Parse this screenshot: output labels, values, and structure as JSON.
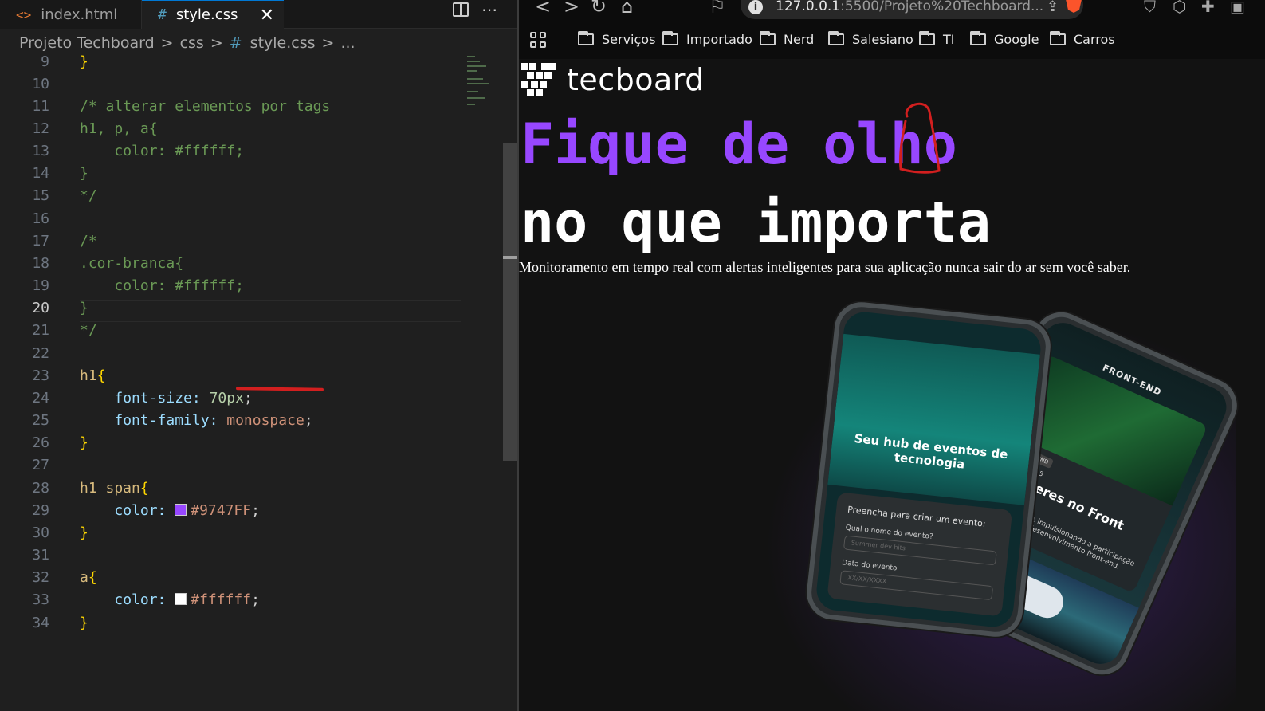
{
  "editor": {
    "tabs": [
      {
        "icon": "<>",
        "label": "index.html"
      },
      {
        "icon": "#",
        "label": "style.css"
      }
    ],
    "close_glyph": "✕",
    "more_glyph": "⋯",
    "breadcrumb": [
      "Projeto Techboard",
      "css",
      "style.css",
      "..."
    ],
    "breadcrumb_sep": ">",
    "breadcrumb_hash": "#",
    "active_line": 20,
    "lines": [
      {
        "n": "9"
      },
      {
        "n": "10"
      },
      {
        "n": "11"
      },
      {
        "n": "12"
      },
      {
        "n": "13"
      },
      {
        "n": "14"
      },
      {
        "n": "15"
      },
      {
        "n": "16"
      },
      {
        "n": "17"
      },
      {
        "n": "18"
      },
      {
        "n": "19"
      },
      {
        "n": "20"
      },
      {
        "n": "21"
      },
      {
        "n": "22"
      },
      {
        "n": "23"
      },
      {
        "n": "24"
      },
      {
        "n": "25"
      },
      {
        "n": "26"
      },
      {
        "n": "27"
      },
      {
        "n": "28"
      },
      {
        "n": "29"
      },
      {
        "n": "30"
      },
      {
        "n": "31"
      },
      {
        "n": "32"
      },
      {
        "n": "33"
      },
      {
        "n": "34"
      }
    ],
    "code": {
      "l9": "}",
      "l11": "/* alterar elementos por tags",
      "l12_sel": "h1, p, a",
      "l13_prop": "color:",
      "l13_val": "#ffffff;",
      "l15": "*/",
      "l17": "/*",
      "l18": ".cor-branca{",
      "l19_prop": "color:",
      "l19_val": "#ffffff;",
      "l20": "}",
      "l21": "*/",
      "l23_sel": "h1",
      "l24_prop": "font-size:",
      "l24_num": "70px",
      "l25_prop": "font-family:",
      "l25_val": "monospace",
      "l26": "}",
      "l28_sel": "h1 span",
      "l29_prop": "color:",
      "l29_val": "#9747FF",
      "l30": "}",
      "l32_sel": "a",
      "l33_prop": "color:",
      "l33_val": "#ffffff",
      "l34": "}",
      "brace_open": "{",
      "brace_close": "}",
      "semicolon": ";"
    },
    "swatch_colors": {
      "purple": "#9747FF",
      "white": "#ffffff"
    }
  },
  "browser": {
    "nav": {
      "back": "<",
      "forward": ">",
      "reload": "↻",
      "home": "⌂",
      "bookmark": "⚐"
    },
    "url_host": "127.0.0.1",
    "url_rest": ":5500/Projeto%20Techboard...",
    "info_glyph": "i",
    "share_glyph": "⇪",
    "ext_glyphs": [
      "⛉",
      "⬡",
      "✚",
      "▣"
    ],
    "bookmarks": [
      "Serviços",
      "Importado",
      "Nerd",
      "Salesiano",
      "TI",
      "Google",
      "Carros"
    ],
    "page": {
      "logo_text": "tecboard",
      "h1_line1": "Fique de olho",
      "h1_line2": "no que importa",
      "subtitle": "Monitoramento em tempo real com alertas inteligentes para sua aplicação nunca sair do ar sem você saber.",
      "phone1": {
        "hero_title": "Seu hub de eventos de tecnologia",
        "form_title": "Preencha para criar um evento:",
        "field1_label": "Qual o nome do evento?",
        "field1_placeholder": "Summer dev hits",
        "field2_label": "Data do evento",
        "field2_placeholder": "XX/XX/XXXX"
      },
      "phone2": {
        "title": "FRONT-END",
        "badge": "FRONT-END",
        "date": "20/05/2025",
        "card_title": "Mulheres no Front",
        "card_desc": "Valorizando e impulsionando a participação feminina no desenvolvimento front-end."
      }
    },
    "accent_color": "#9747ff"
  }
}
